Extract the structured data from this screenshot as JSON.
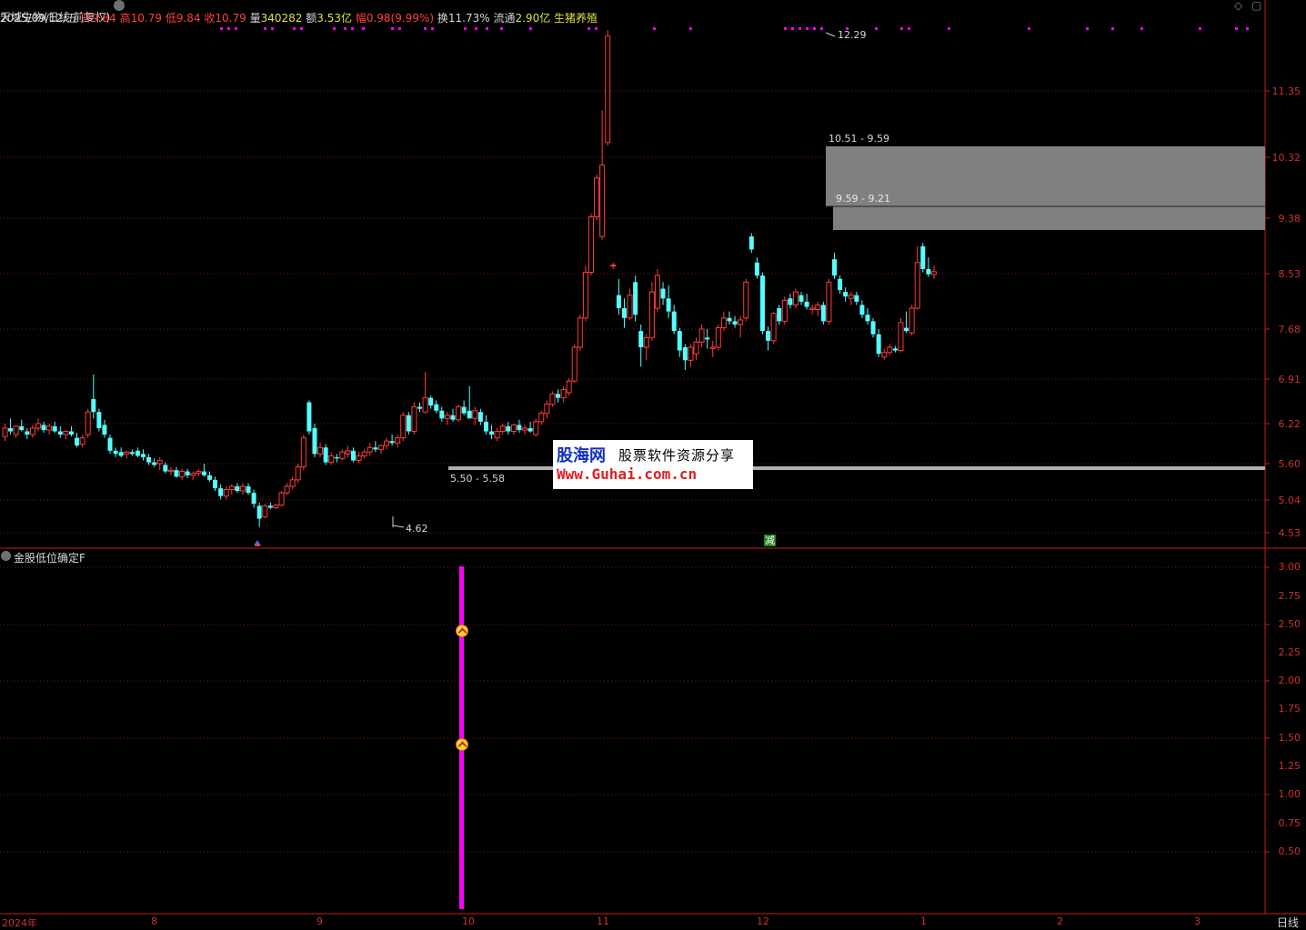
{
  "header": {
    "title": "天域生物(日线 前复权)",
    "date": "2025/09/12/五",
    "open_label": "开",
    "open": "9.84",
    "high_label": "高",
    "high": "10.79",
    "low_label": "低",
    "low": "9.84",
    "close_label": "收",
    "close": "10.79",
    "volume_label": "量",
    "volume": "340282",
    "amount_label": "额",
    "amount": "3.53亿",
    "change_label": "幅",
    "change": "0.98(9.99%)",
    "turnover_label": "换",
    "turnover": "11.73%",
    "float_label": "流通",
    "float": "2.90亿",
    "sector": "生猪养殖"
  },
  "window_buttons": {
    "diamond": "◇",
    "restore": "▢"
  },
  "price_axis": [
    "11.35",
    "10.32",
    "9.38",
    "8.53",
    "7.68",
    "6.91",
    "6.22",
    "5.60",
    "5.04",
    "4.53"
  ],
  "indicator_axis": [
    "3.00",
    "2.75",
    "2.50",
    "2.25",
    "2.00",
    "1.75",
    "1.50",
    "1.25",
    "1.00",
    "0.75",
    "0.50"
  ],
  "time_axis": [
    "2024年",
    "8",
    "9",
    "10",
    "11",
    "12",
    "1",
    "2",
    "3"
  ],
  "period_label": "日线",
  "annotations": {
    "peak": "12.29",
    "low": "4.62",
    "zone_upper": "10.51 - 9.59",
    "zone_mid": "9.59 - 9.21",
    "support": "5.50 - 5.58",
    "reduce_tag": "减"
  },
  "indicator": {
    "name": "金股低位确定F"
  },
  "watermark": {
    "brand": "股海网",
    "slogan": "股票软件资源分享",
    "url": "Www.Guhai.com.cn"
  },
  "colors": {
    "up": "#ff3c3c",
    "down": "#54ffff",
    "grid": "#8a1010",
    "axis": "#c81e1e",
    "signal_bar": "#ff00ff",
    "zone": "#808080",
    "support_line": "#b0b0b0"
  },
  "chart_data": {
    "type": "candlestick",
    "price_ticks": [
      11.35,
      10.32,
      9.38,
      8.53,
      7.68,
      6.91,
      6.22,
      5.6,
      5.04,
      4.53
    ],
    "ylim": [
      4.45,
      12.6
    ],
    "candles": [
      [
        6.02,
        6.22,
        5.95,
        6.15
      ],
      [
        6.15,
        6.3,
        6.05,
        6.1
      ],
      [
        6.05,
        6.2,
        6.0,
        6.18
      ],
      [
        6.18,
        6.28,
        6.1,
        6.12
      ],
      [
        6.1,
        6.15,
        5.98,
        6.05
      ],
      [
        6.05,
        6.2,
        6.0,
        6.15
      ],
      [
        6.15,
        6.3,
        6.1,
        6.22
      ],
      [
        6.2,
        6.25,
        6.08,
        6.12
      ],
      [
        6.12,
        6.22,
        6.05,
        6.18
      ],
      [
        6.18,
        6.25,
        6.08,
        6.1
      ],
      [
        6.1,
        6.18,
        6.0,
        6.05
      ],
      [
        6.05,
        6.12,
        5.98,
        6.1
      ],
      [
        6.1,
        6.18,
        6.02,
        6.05
      ],
      [
        6.0,
        6.08,
        5.85,
        5.88
      ],
      [
        5.9,
        6.05,
        5.85,
        6.0
      ],
      [
        6.05,
        6.45,
        6.0,
        6.4
      ],
      [
        6.6,
        6.98,
        6.3,
        6.4
      ],
      [
        6.4,
        6.45,
        6.1,
        6.15
      ],
      [
        6.2,
        6.28,
        6.0,
        6.05
      ],
      [
        6.0,
        6.05,
        5.75,
        5.8
      ],
      [
        5.8,
        5.85,
        5.7,
        5.75
      ],
      [
        5.78,
        5.85,
        5.7,
        5.72
      ],
      [
        5.75,
        5.8,
        5.68,
        5.78
      ],
      [
        5.78,
        5.82,
        5.72,
        5.75
      ],
      [
        5.8,
        5.85,
        5.7,
        5.72
      ],
      [
        5.75,
        5.82,
        5.65,
        5.7
      ],
      [
        5.7,
        5.75,
        5.58,
        5.62
      ],
      [
        5.62,
        5.68,
        5.55,
        5.58
      ],
      [
        5.6,
        5.7,
        5.5,
        5.65
      ],
      [
        5.58,
        5.62,
        5.45,
        5.48
      ],
      [
        5.48,
        5.55,
        5.42,
        5.5
      ],
      [
        5.5,
        5.55,
        5.38,
        5.4
      ],
      [
        5.4,
        5.52,
        5.35,
        5.48
      ],
      [
        5.48,
        5.52,
        5.38,
        5.42
      ],
      [
        5.42,
        5.48,
        5.35,
        5.45
      ],
      [
        5.45,
        5.52,
        5.4,
        5.48
      ],
      [
        5.48,
        5.6,
        5.4,
        5.42
      ],
      [
        5.42,
        5.48,
        5.32,
        5.35
      ],
      [
        5.35,
        5.4,
        5.18,
        5.22
      ],
      [
        5.22,
        5.28,
        5.05,
        5.1
      ],
      [
        5.1,
        5.25,
        5.05,
        5.2
      ],
      [
        5.2,
        5.28,
        5.12,
        5.25
      ],
      [
        5.25,
        5.3,
        5.15,
        5.18
      ],
      [
        5.18,
        5.3,
        5.12,
        5.25
      ],
      [
        5.25,
        5.3,
        5.12,
        5.15
      ],
      [
        5.15,
        5.2,
        4.92,
        4.98
      ],
      [
        4.95,
        5.0,
        4.62,
        4.75
      ],
      [
        4.78,
        4.98,
        4.75,
        4.95
      ],
      [
        4.95,
        5.0,
        4.9,
        4.92
      ],
      [
        4.92,
        4.98,
        4.9,
        4.96
      ],
      [
        4.96,
        5.18,
        4.94,
        5.15
      ],
      [
        5.15,
        5.3,
        5.12,
        5.25
      ],
      [
        5.25,
        5.4,
        5.2,
        5.35
      ],
      [
        5.35,
        5.6,
        5.3,
        5.55
      ],
      [
        5.55,
        6.05,
        5.5,
        6.0
      ],
      [
        6.55,
        6.58,
        6.05,
        6.1
      ],
      [
        6.15,
        6.22,
        5.7,
        5.75
      ],
      [
        5.75,
        5.92,
        5.7,
        5.85
      ],
      [
        5.85,
        5.9,
        5.58,
        5.62
      ],
      [
        5.62,
        5.78,
        5.58,
        5.72
      ],
      [
        5.7,
        5.75,
        5.62,
        5.68
      ],
      [
        5.68,
        5.82,
        5.65,
        5.78
      ],
      [
        5.75,
        5.88,
        5.7,
        5.8
      ],
      [
        5.8,
        5.85,
        5.62,
        5.65
      ],
      [
        5.65,
        5.78,
        5.6,
        5.72
      ],
      [
        5.72,
        5.82,
        5.68,
        5.78
      ],
      [
        5.78,
        5.92,
        5.72,
        5.85
      ],
      [
        5.85,
        5.95,
        5.78,
        5.82
      ],
      [
        5.82,
        5.9,
        5.75,
        5.88
      ],
      [
        5.88,
        6.0,
        5.82,
        5.95
      ],
      [
        5.95,
        6.05,
        5.88,
        5.92
      ],
      [
        5.92,
        6.05,
        5.85,
        6.0
      ],
      [
        6.0,
        6.4,
        5.95,
        6.35
      ],
      [
        6.35,
        6.4,
        6.05,
        6.1
      ],
      [
        6.1,
        6.55,
        6.05,
        6.48
      ],
      [
        6.48,
        6.55,
        6.4,
        6.45
      ],
      [
        6.4,
        7.02,
        6.38,
        6.62
      ],
      [
        6.62,
        6.65,
        6.45,
        6.5
      ],
      [
        6.52,
        6.58,
        6.38,
        6.42
      ],
      [
        6.42,
        6.48,
        6.25,
        6.3
      ],
      [
        6.3,
        6.4,
        6.2,
        6.35
      ],
      [
        6.35,
        6.45,
        6.25,
        6.28
      ],
      [
        6.28,
        6.52,
        6.25,
        6.48
      ],
      [
        6.48,
        6.58,
        6.35,
        6.38
      ],
      [
        6.42,
        6.8,
        6.4,
        6.3
      ],
      [
        6.3,
        6.48,
        6.2,
        6.42
      ],
      [
        6.4,
        6.45,
        6.2,
        6.25
      ],
      [
        6.25,
        6.35,
        6.05,
        6.1
      ],
      [
        6.1,
        6.2,
        5.98,
        6.05
      ],
      [
        6.0,
        6.15,
        5.95,
        6.1
      ],
      [
        6.1,
        6.22,
        6.05,
        6.18
      ],
      [
        6.18,
        6.25,
        6.05,
        6.1
      ],
      [
        6.1,
        6.22,
        6.05,
        6.2
      ],
      [
        6.2,
        6.28,
        6.08,
        6.12
      ],
      [
        6.12,
        6.2,
        6.05,
        6.15
      ],
      [
        6.15,
        6.25,
        6.08,
        6.1
      ],
      [
        6.05,
        6.3,
        6.02,
        6.25
      ],
      [
        6.25,
        6.42,
        6.2,
        6.38
      ],
      [
        6.38,
        6.58,
        6.3,
        6.52
      ],
      [
        6.52,
        6.72,
        6.48,
        6.68
      ],
      [
        6.68,
        6.75,
        6.55,
        6.62
      ],
      [
        6.62,
        6.8,
        6.55,
        6.75
      ],
      [
        6.7,
        6.92,
        6.65,
        6.88
      ],
      [
        6.88,
        7.45,
        6.85,
        7.4
      ],
      [
        7.4,
        7.9,
        7.35,
        7.85
      ],
      [
        7.85,
        8.65,
        7.8,
        8.55
      ],
      [
        8.55,
        9.45,
        8.5,
        9.4
      ],
      [
        9.4,
        10.05,
        9.35,
        10.0
      ],
      [
        9.1,
        11.05,
        9.05,
        10.2
      ],
      [
        10.55,
        12.29,
        10.5,
        12.2
      ],
      [
        8.65,
        8.7,
        8.6,
        8.66
      ],
      [
        8.2,
        8.45,
        7.9,
        8.0
      ],
      [
        8.0,
        8.15,
        7.7,
        7.85
      ],
      [
        7.85,
        8.3,
        7.82,
        8.2
      ],
      [
        8.4,
        8.5,
        7.8,
        7.9
      ],
      [
        7.65,
        7.75,
        7.1,
        7.4
      ],
      [
        7.4,
        7.6,
        7.2,
        7.55
      ],
      [
        7.55,
        8.4,
        7.5,
        8.25
      ],
      [
        8.0,
        8.6,
        7.95,
        8.5
      ],
      [
        8.3,
        8.4,
        8.05,
        8.15
      ],
      [
        8.15,
        8.35,
        7.85,
        7.95
      ],
      [
        7.95,
        8.05,
        7.6,
        7.65
      ],
      [
        7.65,
        7.7,
        7.25,
        7.35
      ],
      [
        7.4,
        7.45,
        7.05,
        7.2
      ],
      [
        7.2,
        7.45,
        7.1,
        7.4
      ],
      [
        7.3,
        7.55,
        7.2,
        7.48
      ],
      [
        7.48,
        7.75,
        7.4,
        7.68
      ],
      [
        7.55,
        7.68,
        7.38,
        7.52
      ],
      [
        7.38,
        7.5,
        7.25,
        7.4
      ],
      [
        7.4,
        7.75,
        7.35,
        7.7
      ],
      [
        7.7,
        7.95,
        7.65,
        7.85
      ],
      [
        7.85,
        7.95,
        7.75,
        7.8
      ],
      [
        7.8,
        7.88,
        7.7,
        7.75
      ],
      [
        7.75,
        7.88,
        7.55,
        7.82
      ],
      [
        7.85,
        8.45,
        7.8,
        8.4
      ],
      [
        9.1,
        9.15,
        8.85,
        8.9
      ],
      [
        8.7,
        8.78,
        8.45,
        8.5
      ],
      [
        8.5,
        8.55,
        7.6,
        7.65
      ],
      [
        7.65,
        7.72,
        7.35,
        7.5
      ],
      [
        7.5,
        7.95,
        7.45,
        7.92
      ],
      [
        8.0,
        8.05,
        7.75,
        7.8
      ],
      [
        7.8,
        8.18,
        7.75,
        8.12
      ],
      [
        8.15,
        8.22,
        8.0,
        8.05
      ],
      [
        8.05,
        8.3,
        8.0,
        8.25
      ],
      [
        8.2,
        8.25,
        8.05,
        8.1
      ],
      [
        8.1,
        8.22,
        7.98,
        8.02
      ],
      [
        7.98,
        8.05,
        7.9,
        8.0
      ],
      [
        7.98,
        8.1,
        7.88,
        8.05
      ],
      [
        8.05,
        8.1,
        7.75,
        7.8
      ],
      [
        7.8,
        8.45,
        7.75,
        8.4
      ],
      [
        8.75,
        8.85,
        8.45,
        8.5
      ],
      [
        8.45,
        8.5,
        8.22,
        8.28
      ],
      [
        8.25,
        8.32,
        8.1,
        8.18
      ],
      [
        8.15,
        8.25,
        8.05,
        8.2
      ],
      [
        8.2,
        8.25,
        8.05,
        8.1
      ],
      [
        8.05,
        8.12,
        7.85,
        7.9
      ],
      [
        7.9,
        8.0,
        7.75,
        7.8
      ],
      [
        7.8,
        7.85,
        7.55,
        7.6
      ],
      [
        7.6,
        7.68,
        7.25,
        7.3
      ],
      [
        7.25,
        7.38,
        7.2,
        7.32
      ],
      [
        7.32,
        7.45,
        7.28,
        7.4
      ],
      [
        7.38,
        7.42,
        7.32,
        7.35
      ],
      [
        7.35,
        7.85,
        7.32,
        7.78
      ],
      [
        7.7,
        7.95,
        7.62,
        7.65
      ],
      [
        7.62,
        8.05,
        7.58,
        8.0
      ],
      [
        8.0,
        8.95,
        7.98,
        8.7
      ],
      [
        8.95,
        9.0,
        8.55,
        8.6
      ],
      [
        8.6,
        8.78,
        8.48,
        8.52
      ],
      [
        8.52,
        8.65,
        8.45,
        8.56
      ]
    ],
    "indicator": {
      "name": "金股低位确定F",
      "ylim": [
        0,
        3.08
      ],
      "signal_value": 3.0,
      "signal_index": 54,
      "markers": [
        2.5,
        1.5
      ]
    }
  }
}
